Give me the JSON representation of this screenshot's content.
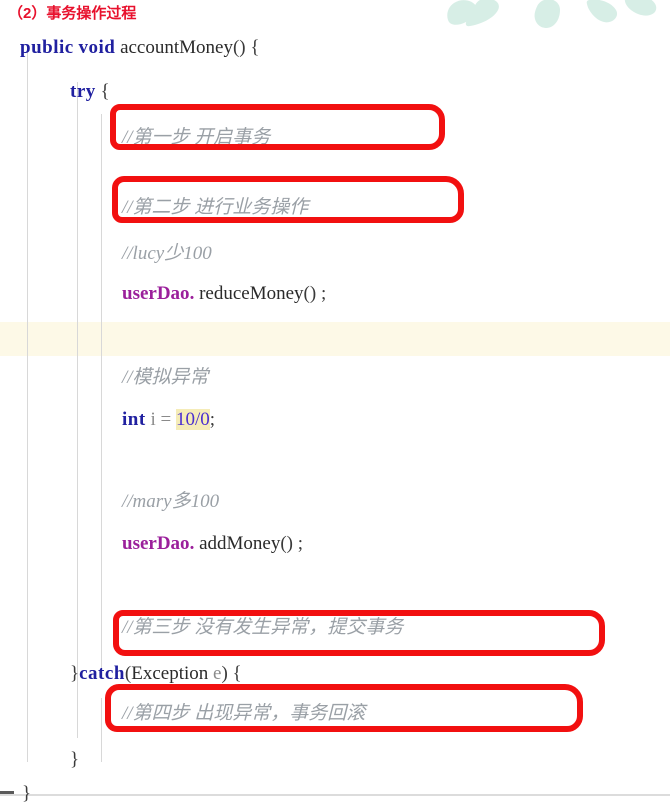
{
  "document": {
    "title": "（2）事务操作过程",
    "title_color": "#e8112d",
    "background_color": "#ffffff"
  },
  "annotations": {
    "box_color": "#f21010",
    "box_count": 4,
    "boxes": [
      {
        "name": "step-1-box",
        "target": "//第一步 开启事务"
      },
      {
        "name": "step-2-box",
        "target": "//第二步 进行业务操作"
      },
      {
        "name": "step-3-box",
        "target": "//第三步 没有发生异常，提交事务"
      },
      {
        "name": "step-4-box",
        "target": "//第四步 出现异常，事务回滚"
      }
    ]
  },
  "editor": {
    "highlight_row_color": "#fdf9e7",
    "selection_color": "#f5ecb8",
    "indent_guide_color": "#d8d8d8"
  },
  "code": {
    "language": "java",
    "lines": [
      {
        "n": 1,
        "indent": 0,
        "text": "public void accountMoney() {"
      },
      {
        "n": 2,
        "indent": 1,
        "text": "try {"
      },
      {
        "n": 3,
        "indent": 2,
        "text": "//第一步 开启事务"
      },
      {
        "n": 4,
        "indent": 2,
        "text": ""
      },
      {
        "n": 5,
        "indent": 2,
        "text": "//第二步 进行业务操作"
      },
      {
        "n": 6,
        "indent": 2,
        "text": "//lucy少100"
      },
      {
        "n": 7,
        "indent": 2,
        "text": "userDao.reduceMoney();"
      },
      {
        "n": 8,
        "indent": 2,
        "text": ""
      },
      {
        "n": 9,
        "indent": 2,
        "text": "//模拟异常"
      },
      {
        "n": 10,
        "indent": 2,
        "text": "int i = 10/0;"
      },
      {
        "n": 11,
        "indent": 2,
        "text": ""
      },
      {
        "n": 12,
        "indent": 2,
        "text": "//mary多100"
      },
      {
        "n": 13,
        "indent": 2,
        "text": "userDao.addMoney();"
      },
      {
        "n": 14,
        "indent": 2,
        "text": ""
      },
      {
        "n": 15,
        "indent": 2,
        "text": "//第三步 没有发生异常，提交事务"
      },
      {
        "n": 16,
        "indent": 1,
        "text": "}catch(Exception e) {"
      },
      {
        "n": 17,
        "indent": 2,
        "text": "//第四步 出现异常，事务回滚"
      },
      {
        "n": 18,
        "indent": 1,
        "text": "}"
      },
      {
        "n": 19,
        "indent": 0,
        "text": "}"
      }
    ],
    "tokens": {
      "kw_public": "public",
      "kw_void": "void",
      "kw_try": "try",
      "kw_catch": "catch",
      "kw_int": "int",
      "method_accountMoney": "accountMoney",
      "field_userDao": "userDao",
      "method_reduceMoney": "reduceMoney",
      "method_addMoney": "addMoney",
      "var_i": "i",
      "num_expr": "10/0",
      "type_exception": "Exception",
      "param_e": "e",
      "comment_step1": "//第一步 开启事务",
      "comment_step2": "//第二步 进行业务操作",
      "comment_lucy": "//lucy少100",
      "comment_mock": "//模拟异常",
      "comment_mary": "//mary多100",
      "comment_step3": "//第三步 没有发生异常，提交事务",
      "comment_step4": "//第四步 出现异常，事务回滚",
      "paren_open": "(",
      "paren_close": ")",
      "parens_empty": "()",
      "brace_open": "{",
      "brace_close": "}",
      "semicolon": ";",
      "dot": ".",
      "equals": "=",
      "space": " "
    }
  }
}
